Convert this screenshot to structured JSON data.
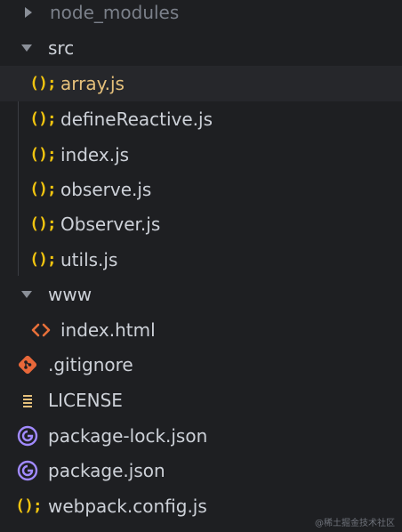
{
  "explorer": {
    "items": [
      {
        "label": "node_modules",
        "type": "folder",
        "expanded": false,
        "icon": "chevron-right-icon"
      },
      {
        "label": "src",
        "type": "folder",
        "expanded": true,
        "icon": "chevron-down-icon"
      },
      {
        "label": "array.js",
        "type": "file",
        "icon": "js-icon",
        "selected": true
      },
      {
        "label": "defineReactive.js",
        "type": "file",
        "icon": "js-icon"
      },
      {
        "label": "index.js",
        "type": "file",
        "icon": "js-icon"
      },
      {
        "label": "observe.js",
        "type": "file",
        "icon": "js-icon"
      },
      {
        "label": "Observer.js",
        "type": "file",
        "icon": "js-icon"
      },
      {
        "label": "utils.js",
        "type": "file",
        "icon": "js-icon"
      },
      {
        "label": "www",
        "type": "folder",
        "expanded": true,
        "icon": "chevron-down-icon"
      },
      {
        "label": "index.html",
        "type": "file",
        "icon": "html-icon"
      },
      {
        "label": ".gitignore",
        "type": "file",
        "icon": "git-icon"
      },
      {
        "label": "LICENSE",
        "type": "file",
        "icon": "license-icon"
      },
      {
        "label": "package-lock.json",
        "type": "file",
        "icon": "npm-icon"
      },
      {
        "label": "package.json",
        "type": "file",
        "icon": "npm-icon"
      },
      {
        "label": "webpack.config.js",
        "type": "file",
        "icon": "js-icon"
      }
    ]
  },
  "colors": {
    "background": "#1e1f22",
    "selected_background": "#26272b",
    "selected_text": "#e5c07b",
    "js_icon": "#f1c40f",
    "html_icon": "#e8703a",
    "git_icon": "#e8683a",
    "npm_icon": "#a18aff",
    "license_icon": "#e5c07b"
  },
  "watermark": "@稀土掘金技术社区"
}
